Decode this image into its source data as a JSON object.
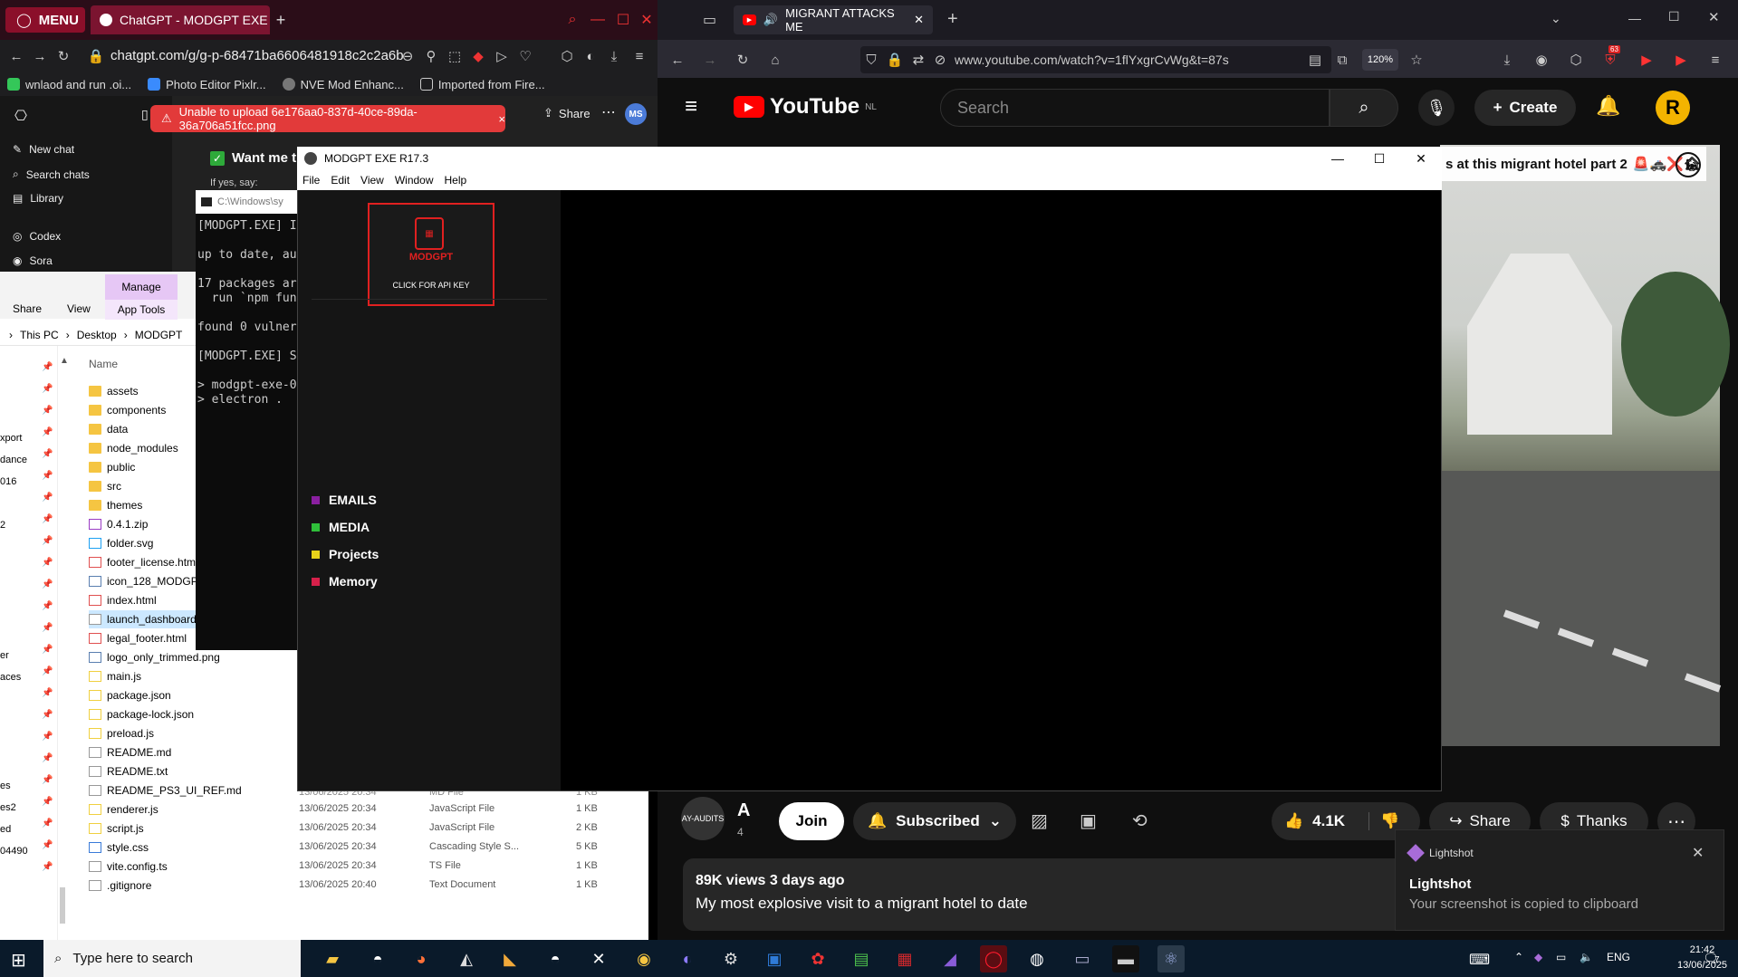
{
  "opera": {
    "menu_label": "MENU",
    "tab_title": "ChatGPT - MODGPT EXE",
    "url": "chatgpt.com/g/g-p-68471ba6606481918c2c2a6b",
    "bookmarks": [
      "wnlaod and run .oi...",
      "Photo Editor Pixlr...",
      "NVE Mod Enhanc...",
      "Imported from Fire..."
    ],
    "sidebar": [
      "New chat",
      "Search chats",
      "Library",
      "Codex",
      "Sora"
    ],
    "error_toast": "Unable to upload 6e176aa0-837d-40ce-89da-36a706a51fcc.png",
    "share_label": "Share",
    "avatar_initials": "MS",
    "message_heading": "Want me t",
    "message_sub": "If yes, say:",
    "colors": {
      "accent": "#8b0f2a",
      "error": "#e23a3a"
    }
  },
  "cmd": {
    "title": "C:\\Windows\\sy",
    "lines": [
      "[MODGPT.EXE] I",
      "",
      "up to date, au",
      "",
      "17 packages ar",
      "  run `npm fun",
      "",
      "found 0 vulner",
      "",
      "[MODGPT.EXE] S",
      "",
      "> modgpt-exe-0",
      "> electron ."
    ],
    "found_zero": "0"
  },
  "explorer": {
    "ribbon_tabs": [
      "Share",
      "View"
    ],
    "manage": "Manage",
    "app_tools": "App Tools",
    "breadcrumb": [
      "This PC",
      "Desktop",
      "MODGPT"
    ],
    "nav_fragments": [
      {
        "text": "xport",
        "y": 0
      },
      {
        "text": "dance",
        "y": 1
      },
      {
        "text": "016",
        "y": 2
      },
      {
        "text": "2",
        "y": 4
      },
      {
        "text": "er",
        "y": 10
      },
      {
        "text": "aces",
        "y": 11
      },
      {
        "text": "es",
        "y": 16
      },
      {
        "text": "es2",
        "y": 17
      },
      {
        "text": "ed",
        "y": 18
      },
      {
        "text": "04490",
        "y": 19
      }
    ],
    "column_name": "Name",
    "files": [
      {
        "name": "assets",
        "kind": "folder"
      },
      {
        "name": "components",
        "kind": "folder"
      },
      {
        "name": "data",
        "kind": "folder"
      },
      {
        "name": "node_modules",
        "kind": "folder"
      },
      {
        "name": "public",
        "kind": "folder"
      },
      {
        "name": "src",
        "kind": "folder"
      },
      {
        "name": "themes",
        "kind": "folder"
      },
      {
        "name": "0.4.1.zip",
        "kind": "zip"
      },
      {
        "name": "folder.svg",
        "kind": "svg"
      },
      {
        "name": "footer_license.htm",
        "kind": "html"
      },
      {
        "name": "icon_128_MODGP",
        "kind": "img"
      },
      {
        "name": "index.html",
        "kind": "html"
      },
      {
        "name": "launch_dashboard",
        "kind": "file"
      },
      {
        "name": "legal_footer.html",
        "kind": "html"
      },
      {
        "name": "logo_only_trimmed.png",
        "kind": "img"
      },
      {
        "name": "main.js",
        "kind": "js"
      },
      {
        "name": "package.json",
        "kind": "js"
      },
      {
        "name": "package-lock.json",
        "kind": "js"
      },
      {
        "name": "preload.js",
        "kind": "js"
      },
      {
        "name": "README.md",
        "kind": "txt"
      },
      {
        "name": "README.txt",
        "kind": "txt"
      },
      {
        "name": "README_PS3_UI_REF.md",
        "kind": "txt"
      },
      {
        "name": "renderer.js",
        "kind": "js",
        "date": "13/06/2025 20:34",
        "type": "JavaScript File",
        "size": "1 KB"
      },
      {
        "name": "script.js",
        "kind": "js",
        "date": "13/06/2025 20:34",
        "type": "JavaScript File",
        "size": "2 KB"
      },
      {
        "name": "style.css",
        "kind": "css",
        "date": "13/06/2025 20:34",
        "type": "Cascading Style S...",
        "size": "5 KB"
      },
      {
        "name": "vite.config.ts",
        "kind": "txt",
        "date": "13/06/2025 20:34",
        "type": "TS File",
        "size": "1 KB"
      },
      {
        "name": ".gitignore",
        "kind": "txt",
        "date": "13/06/2025 20:40",
        "type": "Text Document",
        "size": "1 KB"
      }
    ],
    "partial_row": {
      "date": "13/06/2025 20:34",
      "type": "MD File",
      "size": "1 KB"
    }
  },
  "modgpt": {
    "title": "MODGPT EXE R17.3",
    "menu": [
      "File",
      "Edit",
      "View",
      "Window",
      "Help"
    ],
    "api_box_name": "MODGPT",
    "api_box_cta": "CLICK FOR API KEY",
    "nav": [
      {
        "label": "EMAILS",
        "color": "#8a1fa0"
      },
      {
        "label": "MEDIA",
        "color": "#2fbf3a"
      },
      {
        "label": "Projects",
        "color": "#e8d21a"
      },
      {
        "label": "Memory",
        "color": "#d6204a"
      }
    ]
  },
  "firefox": {
    "tab_title": "MIGRANT ATTACKS ME",
    "url": "www.youtube.com/watch?v=1flYxgrCvWg&t=87s",
    "zoom": "120%",
    "badge": "63"
  },
  "youtube": {
    "logo": "YouTube",
    "region": "NL",
    "search_placeholder": "Search",
    "create_label": "Create",
    "avatar_letter": "R",
    "video_title_overlay": "s at this migrant hotel part 2",
    "channel_name": "A",
    "channel_subs": "4",
    "channel_avatar_text": "AY-AUDITS",
    "join_label": "Join",
    "subscribed_label": "Subscribed",
    "likes": "4.1K",
    "share_label": "Share",
    "thanks_label": "Thanks",
    "views_date": "89K views  3 days ago",
    "description": "My most explosive visit to a migrant hotel to date"
  },
  "lightshot": {
    "app": "Lightshot",
    "title": "Lightshot",
    "message": "Your screenshot is copied to clipboard"
  },
  "taskbar": {
    "search_placeholder": "Type here to search",
    "lang": "ENG",
    "time": "21:42",
    "date": "13/06/2025",
    "notification_count": "7"
  }
}
